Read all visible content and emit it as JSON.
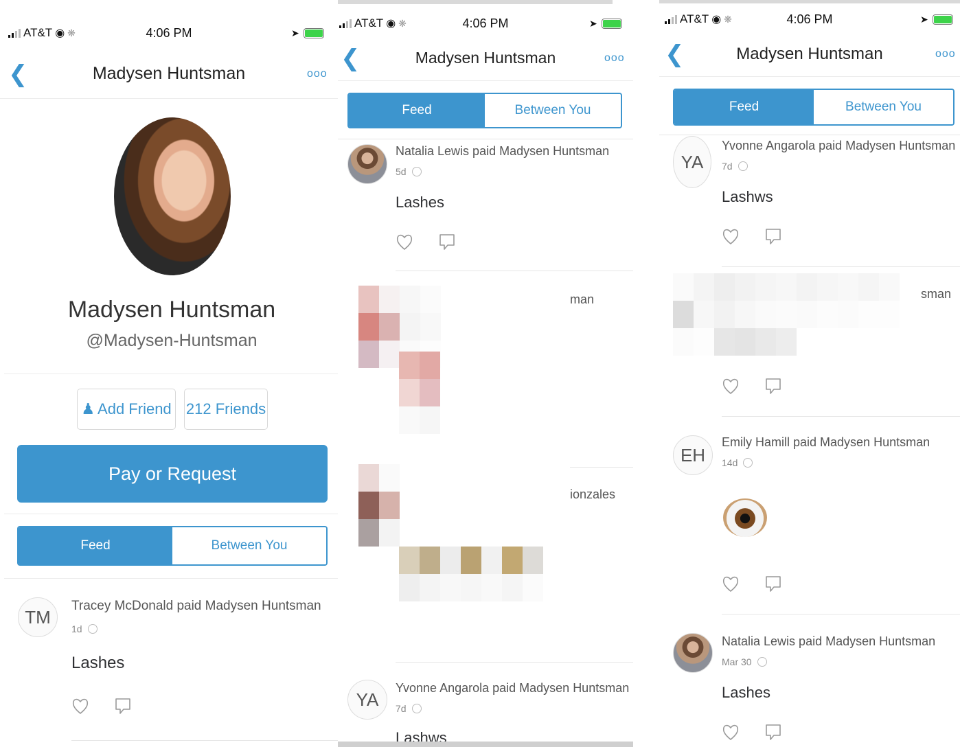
{
  "status": {
    "carrier": "AT&T",
    "time": "4:06 PM"
  },
  "nav": {
    "title": "Madysen Huntsman",
    "more": "ooo"
  },
  "profile": {
    "name": "Madysen Huntsman",
    "username": "@Madysen-Huntsman",
    "add_friend": "Add Friend",
    "friends": "212 Friends",
    "pay_request": "Pay or Request"
  },
  "tabs": {
    "feed": "Feed",
    "between": "Between You"
  },
  "stories": {
    "tracey": {
      "initials": "TM",
      "headline": "Tracey McDonald paid Madysen Huntsman",
      "time": "1d",
      "note": "Lashes"
    },
    "natalia_1": {
      "headline": "Natalia Lewis paid Madysen Huntsman",
      "time": "5d",
      "note": "Lashes"
    },
    "blur_1_tail": "man",
    "blur_2_tail": "ionzales",
    "yvonne": {
      "initials": "YA",
      "headline": "Yvonne Angarola paid Madysen Huntsman",
      "time": "7d",
      "note": "Lashws"
    },
    "blur_3_tail": "sman",
    "emily": {
      "initials": "EH",
      "headline": "Emily Hamill paid Madysen Huntsman",
      "time": "14d"
    },
    "natalia_2": {
      "headline": "Natalia Lewis paid Madysen Huntsman",
      "time": "Mar 30",
      "note": "Lashes"
    }
  },
  "colors": {
    "accent": "#3d95ce",
    "battery": "#3dd34a"
  },
  "icons": [
    "back-chevron-icon",
    "more-dots-icon",
    "add-person-icon",
    "heart-icon",
    "comment-icon",
    "globe-icon",
    "eye-emoji"
  ]
}
